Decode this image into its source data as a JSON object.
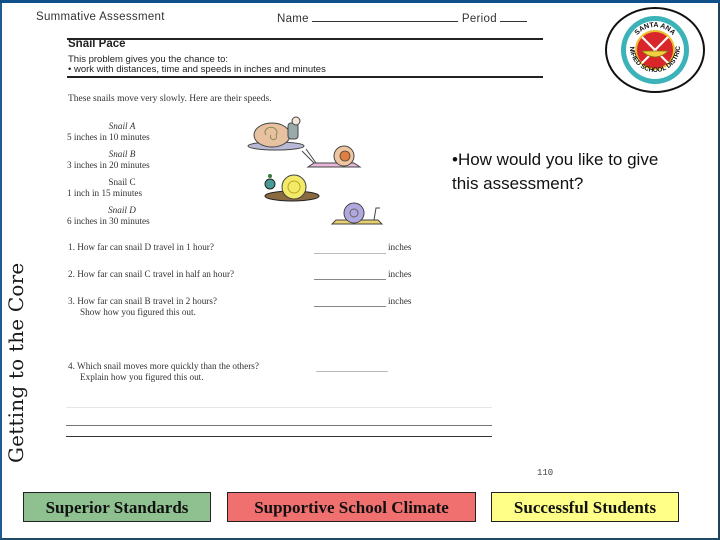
{
  "slide": {
    "side_title": "Getting to the Core",
    "prompt": "•How would you like to give this assessment?",
    "frame_color": "#1f5b8e"
  },
  "worksheet": {
    "header_title": "Summative Assessment",
    "name_label": "Name",
    "period_label": "Period",
    "task_title": "Snail Pace",
    "intro_line1": "This problem gives you the chance to:",
    "intro_line2": "• work with distances, time and speeds in inches and minutes",
    "speeds_intro": "These snails move very slowly. Here are their speeds.",
    "snails": [
      {
        "name": "Snail A",
        "speed": "5 inches in 10 minutes"
      },
      {
        "name": "Snail B",
        "speed": "3 inches in 20 minutes"
      },
      {
        "name": "Snail C",
        "speed": "1 inch in 15 minutes"
      },
      {
        "name": "Snail D",
        "speed": "6 inches in 30 minutes"
      }
    ],
    "questions": [
      {
        "text": "1. How far can snail D travel in 1 hour?",
        "unit": "inches"
      },
      {
        "text": "2. How far can snail C travel in half an hour?",
        "unit": "inches"
      },
      {
        "text": "3. How far can snail B travel in 2 hours?",
        "subtext": "Show how you figured this out.",
        "unit": "inches"
      },
      {
        "text": "4. Which snail moves more quickly than the others?",
        "subtext": "Explain how you figured this out."
      }
    ],
    "page_number": "110"
  },
  "logo": {
    "top_text": "SANTA ANA",
    "ring_text": "UNIFIED SCHOOL DISTRICT"
  },
  "pillars": [
    {
      "label": "Superior Standards",
      "color": "#8fc08f"
    },
    {
      "label": "Supportive School Climate",
      "color": "#f07070"
    },
    {
      "label": "Successful Students",
      "color": "#ffff88"
    }
  ]
}
